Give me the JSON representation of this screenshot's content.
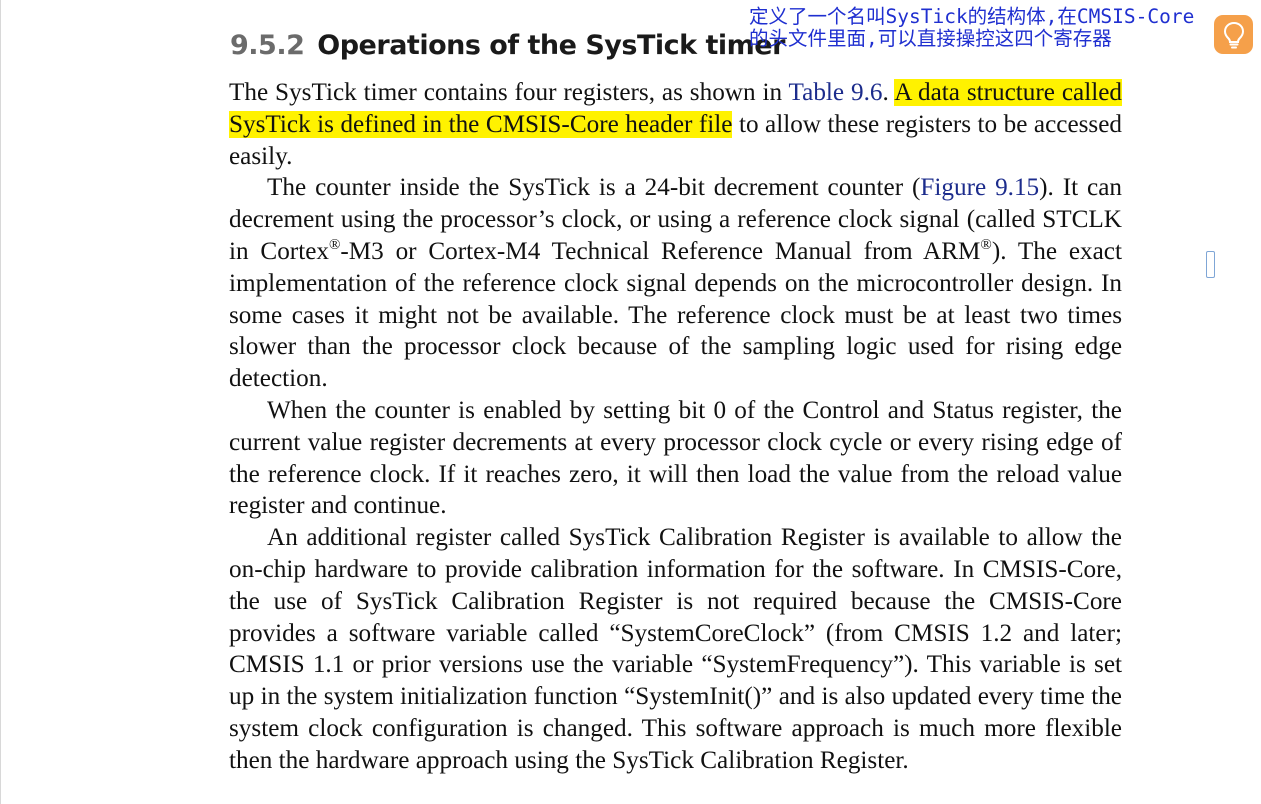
{
  "heading": {
    "number": "9.5.2",
    "title": "Operations of the SysTick timer"
  },
  "annotation": {
    "note_text": "定义了一个名叫SysTick的结构体,在CMSIS-Core的头文件里面,可以直接操控这四个寄存器",
    "icon": "lightbulb-icon",
    "icon_color": "#f5a04a",
    "text_color": "#1f2fd0",
    "highlight_color": "#fff200"
  },
  "paragraphs": {
    "p1": {
      "part1": "The SysTick timer contains four registers, as shown in ",
      "ref1": "Table 9.6",
      "part2": ". ",
      "highlight": "A data structure called SysTick is defined in the CMSIS-Core header file",
      "part3": " to allow these registers to be accessed easily."
    },
    "p2": {
      "part1": "The counter inside the SysTick is a 24-bit decrement counter (",
      "ref1": "Figure 9.15",
      "part2": "). It can decrement using the processor’s clock, or using a reference clock signal (called STCLK in Cortex",
      "reg1": "®",
      "part3": "-M3 or Cortex-M4 Technical Reference Manual from ARM",
      "reg2": "®",
      "part4": "). The exact implementation of the reference clock signal depends on the microcon­troller design. In some cases it might not be available. The reference clock must be at least two times slower than the processor clock because of the sampling logic used for rising edge detection."
    },
    "p3": "When the counter is enabled by setting bit 0 of the Control and Status register, the current value register decrements at every processor clock cycle or every rising edge of the reference clock. If it reaches zero, it will then load the value from the reload value register and continue.",
    "p4": "An additional register called SysTick Calibration Register is available to allow the on-chip hardware to provide calibration information for the software. In CMSIS-Core, the use of SysTick Calibration Register is not required because the CMSIS-Core provides a software variable called “SystemCoreClock” (from CMSIS 1.2 and later; CMSIS 1.1 or prior versions use the variable “SystemFrequency”). This variable is set up in the system initialization function “SystemInit()” and is also updated every time the system clock configuration is changed. This software approach is much more flexible then the hardware approach using the SysTick Calibration Register."
  }
}
